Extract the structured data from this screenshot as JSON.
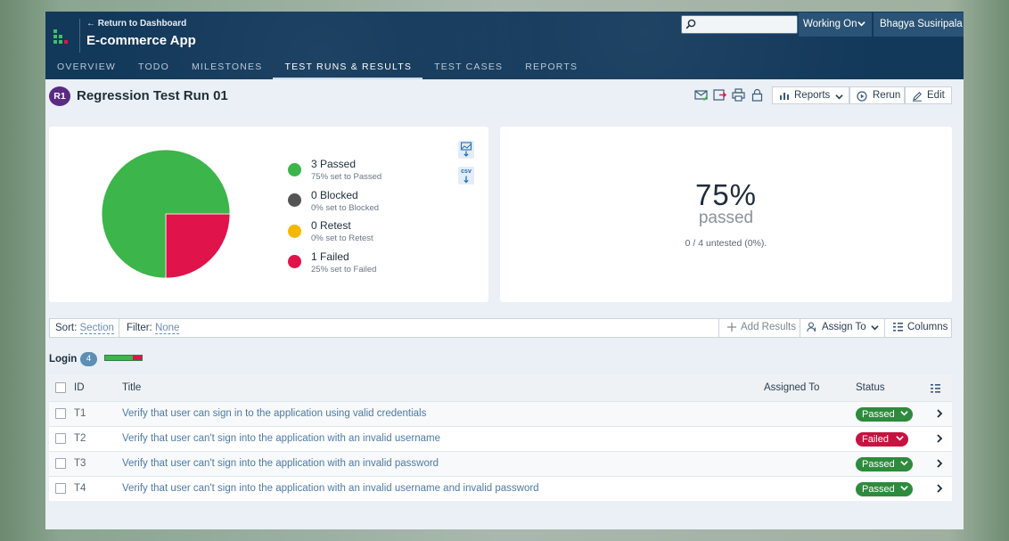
{
  "header": {
    "back_link": "← Return to Dashboard",
    "app_title": "E-commerce App",
    "nav": [
      "OVERVIEW",
      "TODO",
      "MILESTONES",
      "TEST RUNS & RESULTS",
      "TEST CASES",
      "REPORTS"
    ],
    "active_nav": "TEST RUNS & RESULTS",
    "search_placeholder": "",
    "working_on": "Working On",
    "user_name": "Bhagya Susiripala"
  },
  "run": {
    "badge": "R1",
    "title": "Regression Test Run 01",
    "reports_label": "Reports",
    "rerun_label": "Rerun",
    "edit_label": "Edit"
  },
  "stats": {
    "legend": [
      {
        "label": "3 Passed",
        "sub": "75% set to Passed",
        "color": "#3cb54a"
      },
      {
        "label": "0 Blocked",
        "sub": "0% set to Blocked",
        "color": "#545454"
      },
      {
        "label": "0 Retest",
        "sub": "0% set to Retest",
        "color": "#f5b800"
      },
      {
        "label": "1 Failed",
        "sub": "25% set to Failed",
        "color": "#e0134a"
      }
    ],
    "export_csv_label": "csv",
    "percent": "75%",
    "percent_word": "passed",
    "untested": "0 / 4 untested (0%)."
  },
  "chart_data": {
    "type": "pie",
    "labels": [
      "Passed",
      "Blocked",
      "Retest",
      "Failed"
    ],
    "values": [
      3,
      0,
      0,
      1
    ],
    "colors": [
      "#3cb54a",
      "#545454",
      "#f5b800",
      "#e0134a"
    ]
  },
  "filterbar": {
    "sort_label": "Sort:",
    "sort_value": "Section",
    "filter_label": "Filter:",
    "filter_value": "None",
    "add_results": "Add Results",
    "assign_to": "Assign To",
    "columns": "Columns"
  },
  "section": {
    "title": "Login",
    "count": "4",
    "passed_fraction": 0.75,
    "failed_fraction": 0.25
  },
  "table": {
    "headers": {
      "id": "ID",
      "title": "Title",
      "assigned": "Assigned To",
      "status": "Status"
    },
    "rows": [
      {
        "id": "T1",
        "title": "Verify that user can sign in to the application using valid credentials",
        "status": "Passed"
      },
      {
        "id": "T2",
        "title": "Verify that user can't sign into the application with an invalid username",
        "status": "Failed"
      },
      {
        "id": "T3",
        "title": "Verify that user can't sign into the application with an invalid password",
        "status": "Passed"
      },
      {
        "id": "T4",
        "title": "Verify that user can't sign into the application with an invalid username and invalid password",
        "status": "Passed"
      }
    ]
  },
  "colors": {
    "passed": "#2e8b3d",
    "failed": "#c7123f",
    "header_bg": "#12385a"
  }
}
